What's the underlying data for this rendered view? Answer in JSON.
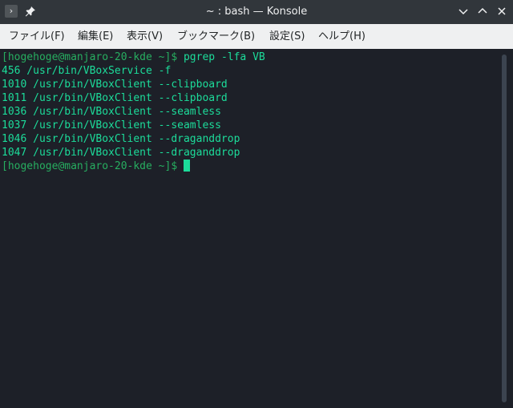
{
  "window": {
    "title": "~ : bash — Konsole"
  },
  "menu": {
    "items": [
      {
        "label": "ファイル(F)"
      },
      {
        "label": "編集(E)"
      },
      {
        "label": "表示(V)"
      },
      {
        "label": "ブックマーク(B)"
      },
      {
        "label": "設定(S)"
      },
      {
        "label": "ヘルプ(H)"
      }
    ]
  },
  "terminal": {
    "prompt1": "[hogehoge@manjaro-20-kde ~]$",
    "command1": " pgrep -lfa VB",
    "output": [
      "456 /usr/bin/VBoxService -f",
      "1010 /usr/bin/VBoxClient --clipboard",
      "1011 /usr/bin/VBoxClient --clipboard",
      "1036 /usr/bin/VBoxClient --seamless",
      "1037 /usr/bin/VBoxClient --seamless",
      "1046 /usr/bin/VBoxClient --draganddrop",
      "1047 /usr/bin/VBoxClient --draganddrop"
    ],
    "prompt2": "[hogehoge@manjaro-20-kde ~]$"
  },
  "colors": {
    "prompt": "#27ae60",
    "text": "#1cdc9a",
    "background": "#1d2028",
    "titlebar": "#31363b",
    "menubar": "#eff0f1"
  },
  "icons": {
    "app": "konsole-terminal-icon",
    "pin": "pin-icon",
    "minimize": "chevron-down-icon",
    "maximize": "chevron-up-icon",
    "close": "close-icon"
  }
}
